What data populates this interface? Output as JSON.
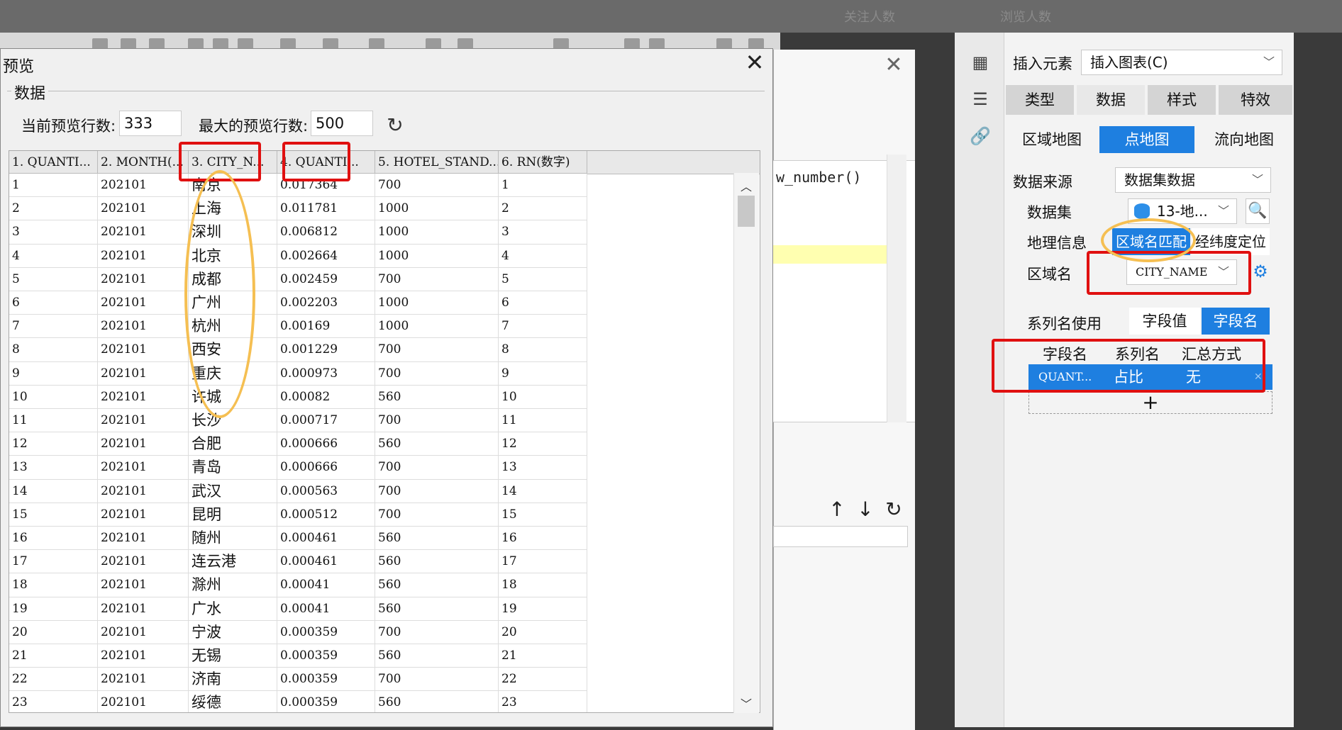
{
  "topbar": {
    "tab1": "关注人数",
    "tab2": "浏览人数"
  },
  "code": {
    "text": "w_number()"
  },
  "right_panel": {
    "insert_element_label": "插入元素",
    "insert_element_value": "插入图表(C)",
    "tabs": [
      "类型",
      "数据",
      "样式",
      "特效"
    ],
    "map_types": [
      "区域地图",
      "点地图",
      "流向地图"
    ],
    "data_source_label": "数据来源",
    "data_source_value": "数据集数据",
    "dataset_label": "数据集",
    "dataset_value": "13-地...",
    "geo_label": "地理信息",
    "geo_options": [
      "区域名匹配",
      "经纬度定位"
    ],
    "region_label": "区域名",
    "region_value": "CITY_NAME",
    "series_label": "系列名使用",
    "series_options": [
      "字段值",
      "字段名"
    ],
    "field_table": {
      "headers": [
        "字段名",
        "系列名",
        "汇总方式"
      ],
      "row": [
        "QUANT...",
        "占比",
        "无"
      ],
      "add": "+"
    }
  },
  "preview": {
    "title": "预览",
    "close": "✕",
    "group_title": "数据",
    "current_rows_label": "当前预览行数:",
    "current_rows_value": "333",
    "max_rows_label": "最大的预览行数:",
    "max_rows_value": "500",
    "refresh_icon": "↻",
    "columns": [
      "1. QUANTI...",
      "2. MONTH(...",
      "3. CITY_N...",
      "4. QUANTI...",
      "5. HOTEL_STAND...",
      "6. RN(数字)"
    ],
    "rows": [
      [
        "1",
        "202101",
        "南京",
        "0.017364",
        "700",
        "1"
      ],
      [
        "2",
        "202101",
        "上海",
        "0.011781",
        "1000",
        "2"
      ],
      [
        "3",
        "202101",
        "深圳",
        "0.006812",
        "1000",
        "3"
      ],
      [
        "4",
        "202101",
        "北京",
        "0.002664",
        "1000",
        "4"
      ],
      [
        "5",
        "202101",
        "成都",
        "0.002459",
        "700",
        "5"
      ],
      [
        "6",
        "202101",
        "广州",
        "0.002203",
        "1000",
        "6"
      ],
      [
        "7",
        "202101",
        "杭州",
        "0.00169",
        "1000",
        "7"
      ],
      [
        "8",
        "202101",
        "西安",
        "0.001229",
        "700",
        "8"
      ],
      [
        "9",
        "202101",
        "重庆",
        "0.000973",
        "700",
        "9"
      ],
      [
        "10",
        "202101",
        "许城",
        "0.00082",
        "560",
        "10"
      ],
      [
        "11",
        "202101",
        "长沙",
        "0.000717",
        "700",
        "11"
      ],
      [
        "12",
        "202101",
        "合肥",
        "0.000666",
        "560",
        "12"
      ],
      [
        "13",
        "202101",
        "青岛",
        "0.000666",
        "700",
        "13"
      ],
      [
        "14",
        "202101",
        "武汉",
        "0.000563",
        "700",
        "14"
      ],
      [
        "15",
        "202101",
        "昆明",
        "0.000512",
        "700",
        "15"
      ],
      [
        "16",
        "202101",
        "随州",
        "0.000461",
        "560",
        "16"
      ],
      [
        "17",
        "202101",
        "连云港",
        "0.000461",
        "560",
        "17"
      ],
      [
        "18",
        "202101",
        "滁州",
        "0.00041",
        "560",
        "18"
      ],
      [
        "19",
        "202101",
        "广水",
        "0.00041",
        "560",
        "19"
      ],
      [
        "20",
        "202101",
        "宁波",
        "0.000359",
        "700",
        "20"
      ],
      [
        "21",
        "202101",
        "无锡",
        "0.000359",
        "560",
        "21"
      ],
      [
        "22",
        "202101",
        "济南",
        "0.000359",
        "700",
        "22"
      ],
      [
        "23",
        "202101",
        "绥德",
        "0.000359",
        "560",
        "23"
      ]
    ]
  },
  "colors": {
    "accent": "#1e7fe0",
    "highlight_red": "#e01010",
    "highlight_orange": "#f5bf52"
  }
}
